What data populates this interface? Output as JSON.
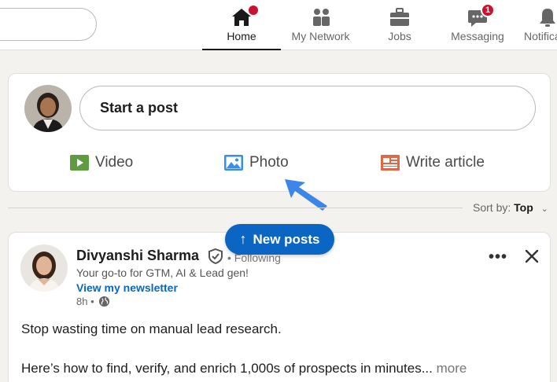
{
  "nav": {
    "items": [
      {
        "label": "Home",
        "icon": "home-icon"
      },
      {
        "label": "My Network",
        "icon": "network-icon"
      },
      {
        "label": "Jobs",
        "icon": "briefcase-icon"
      },
      {
        "label": "Messaging",
        "icon": "messaging-icon",
        "badge": "1"
      },
      {
        "label": "Notifications",
        "icon": "bell-icon"
      }
    ],
    "active": "Home"
  },
  "composer": {
    "prompt": "Start a post",
    "actions": [
      {
        "label": "Video",
        "icon": "video-icon",
        "color": "#5f9b41"
      },
      {
        "label": "Photo",
        "icon": "photo-icon",
        "color": "#378fe9"
      },
      {
        "label": "Write article",
        "icon": "article-icon",
        "color": "#e06847"
      }
    ]
  },
  "sort": {
    "label": "Sort by:",
    "value": "Top"
  },
  "new_posts": "New posts",
  "post": {
    "author": "Divyanshi Sharma",
    "following": "• Following",
    "headline": "Your go-to for GTM, AI & Lead gen!",
    "newsletter": "View my newsletter",
    "time": "8h •",
    "line1": "Stop wasting time on manual lead research.",
    "line2": "Here’s how to find, verify, and enrich 1,000s of prospects in minutes...",
    "more": "more",
    "menu": "•••"
  },
  "colors": {
    "accent": "#0a66c2",
    "badge": "#cb112d"
  }
}
